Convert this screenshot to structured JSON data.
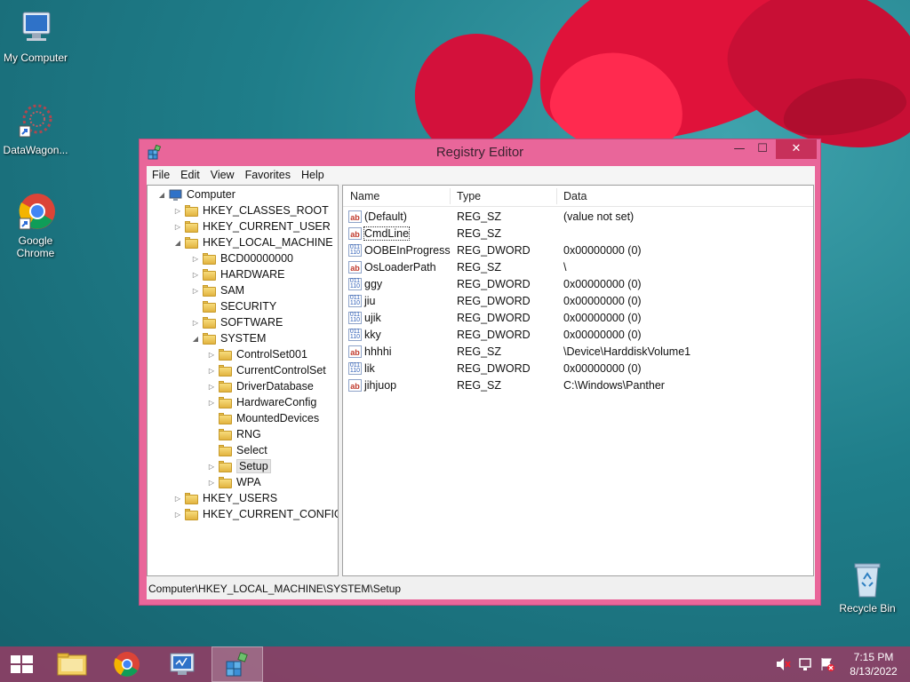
{
  "desktop": {
    "icons": [
      {
        "label": "My Computer"
      },
      {
        "label": "DataWagon..."
      },
      {
        "label": "Google Chrome"
      },
      {
        "label": "Recycle Bin"
      }
    ]
  },
  "window": {
    "title": "Registry Editor",
    "controls": {
      "minimize": "—",
      "maximize": "☐",
      "close": "✕"
    },
    "menu": [
      "File",
      "Edit",
      "View",
      "Favorites",
      "Help"
    ],
    "tree": [
      {
        "label": "Computer",
        "level": 0,
        "exp": "◢"
      },
      {
        "label": "HKEY_CLASSES_ROOT",
        "level": 1,
        "exp": "▷"
      },
      {
        "label": "HKEY_CURRENT_USER",
        "level": 1,
        "exp": "▷"
      },
      {
        "label": "HKEY_LOCAL_MACHINE",
        "level": 1,
        "exp": "◢"
      },
      {
        "label": "BCD00000000",
        "level": 2,
        "exp": "▷"
      },
      {
        "label": "HARDWARE",
        "level": 2,
        "exp": "▷"
      },
      {
        "label": "SAM",
        "level": 2,
        "exp": "▷"
      },
      {
        "label": "SECURITY",
        "level": 2,
        "exp": ""
      },
      {
        "label": "SOFTWARE",
        "level": 2,
        "exp": "▷"
      },
      {
        "label": "SYSTEM",
        "level": 2,
        "exp": "◢"
      },
      {
        "label": "ControlSet001",
        "level": 3,
        "exp": "▷"
      },
      {
        "label": "CurrentControlSet",
        "level": 3,
        "exp": "▷"
      },
      {
        "label": "DriverDatabase",
        "level": 3,
        "exp": "▷"
      },
      {
        "label": "HardwareConfig",
        "level": 3,
        "exp": "▷"
      },
      {
        "label": "MountedDevices",
        "level": 3,
        "exp": ""
      },
      {
        "label": "RNG",
        "level": 3,
        "exp": ""
      },
      {
        "label": "Select",
        "level": 3,
        "exp": ""
      },
      {
        "label": "Setup",
        "level": 3,
        "exp": "▷",
        "selected": true
      },
      {
        "label": "WPA",
        "level": 3,
        "exp": "▷"
      },
      {
        "label": "HKEY_USERS",
        "level": 1,
        "exp": "▷"
      },
      {
        "label": "HKEY_CURRENT_CONFIG",
        "level": 1,
        "exp": "▷"
      }
    ],
    "columns": {
      "name": "Name",
      "type": "Type",
      "data": "Data"
    },
    "values": [
      {
        "name": "(Default)",
        "type": "REG_SZ",
        "data": "(value not set)",
        "kind": "sz"
      },
      {
        "name": "CmdLine",
        "type": "REG_SZ",
        "data": "",
        "kind": "sz",
        "focus": true
      },
      {
        "name": "OOBEInProgress",
        "type": "REG_DWORD",
        "data": "0x00000000 (0)",
        "kind": "dw"
      },
      {
        "name": "OsLoaderPath",
        "type": "REG_SZ",
        "data": "\\",
        "kind": "sz"
      },
      {
        "name": "ggy",
        "type": "REG_DWORD",
        "data": "0x00000000 (0)",
        "kind": "dw"
      },
      {
        "name": "jiu",
        "type": "REG_DWORD",
        "data": "0x00000000 (0)",
        "kind": "dw"
      },
      {
        "name": "ujik",
        "type": "REG_DWORD",
        "data": "0x00000000 (0)",
        "kind": "dw"
      },
      {
        "name": "kky",
        "type": "REG_DWORD",
        "data": "0x00000000 (0)",
        "kind": "dw"
      },
      {
        "name": "hhhhi",
        "type": "REG_SZ",
        "data": "\\Device\\HarddiskVolume1",
        "kind": "sz"
      },
      {
        "name": "lik",
        "type": "REG_DWORD",
        "data": "0x00000000 (0)",
        "kind": "dw"
      },
      {
        "name": "jihjuop",
        "type": "REG_SZ",
        "data": "C:\\Windows\\Panther",
        "kind": "sz"
      }
    ],
    "status": "Computer\\HKEY_LOCAL_MACHINE\\SYSTEM\\Setup"
  },
  "taskbar": {
    "time": "7:15 PM",
    "date": "8/13/2022"
  }
}
